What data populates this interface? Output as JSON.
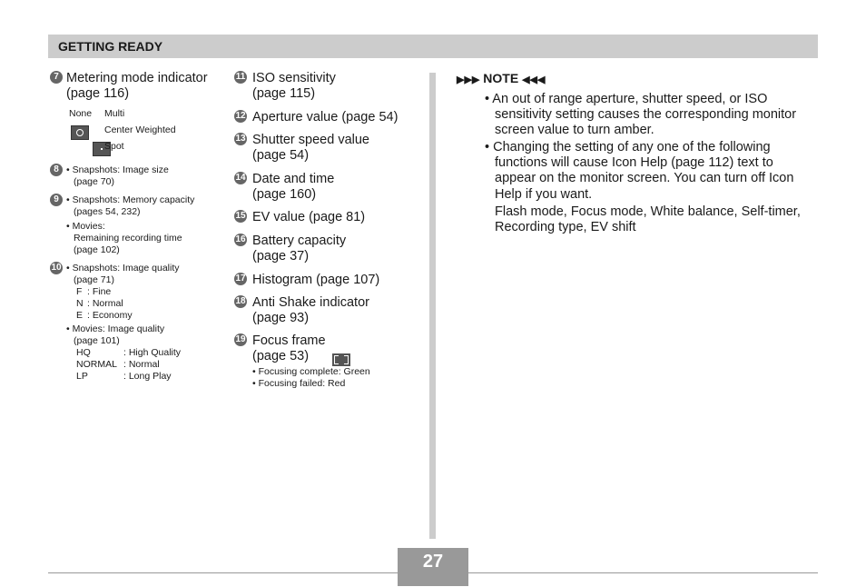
{
  "header": {
    "title": "GETTING READY"
  },
  "col1": {
    "item7": {
      "num": "7",
      "title": "Metering mode indicator",
      "page": "(page 116)"
    },
    "metering": [
      {
        "icon": "none",
        "label": "None",
        "name": "Multi"
      },
      {
        "icon": "center-weighted-icon",
        "name": "Center Weighted"
      },
      {
        "icon": "spot-icon",
        "name": "Spot"
      }
    ],
    "item8": {
      "num": "8",
      "lines": [
        "• Snapshots: Image size",
        "(page 70)"
      ]
    },
    "item9": {
      "num": "9",
      "lines": [
        "• Snapshots: Memory capacity",
        "(pages 54, 232)"
      ],
      "movies": [
        "• Movies:",
        "Remaining recording time",
        "(page 102)"
      ]
    },
    "item10": {
      "num": "10",
      "lines": [
        "• Snapshots: Image quality",
        "(page 71)"
      ],
      "snap_q": [
        {
          "k": "F",
          "v": ": Fine"
        },
        {
          "k": "N",
          "v": ": Normal"
        },
        {
          "k": "E",
          "v": ": Economy"
        }
      ],
      "movies": [
        "• Movies: Image quality",
        "(page 101)"
      ],
      "movie_q": [
        {
          "k": "HQ",
          "v": ": High Quality"
        },
        {
          "k": "NORMAL",
          "v": ": Normal"
        },
        {
          "k": "LP",
          "v": ": Long Play"
        }
      ]
    }
  },
  "col2": {
    "items": [
      {
        "num": "11",
        "line1": "ISO sensitivity",
        "line2": "(page 115)"
      },
      {
        "num": "12",
        "line1": "Aperture value (page 54)",
        "line2": ""
      },
      {
        "num": "13",
        "line1": "Shutter speed value",
        "line2": "(page 54)"
      },
      {
        "num": "14",
        "line1": "Date and time",
        "line2": "(page 160)"
      },
      {
        "num": "15",
        "line1": "EV value (page 81)",
        "line2": ""
      },
      {
        "num": "16",
        "line1": "Battery capacity",
        "line2": "(page 37)"
      },
      {
        "num": "17",
        "line1": "Histogram (page 107)",
        "line2": ""
      },
      {
        "num": "18",
        "line1": "Anti Shake indicator",
        "line2": "(page 93)"
      },
      {
        "num": "19",
        "line1": "Focus frame",
        "line2": "(page 53)"
      }
    ],
    "focus_notes": [
      "•  Focusing complete: Green",
      "•  Focusing failed: Red"
    ]
  },
  "note": {
    "label": "NOTE",
    "bullets": [
      "• An out of range aperture, shutter speed, or ISO",
      "sensitivity setting causes the corresponding monitor",
      "screen value to turn amber.",
      "• Changing the setting of any one of the following",
      "functions will cause Icon Help (page 112) text to",
      "appear on the monitor screen. You can turn off Icon",
      "Help if you want.",
      "Flash mode, Focus mode, White balance, Self-timer,",
      "Recording type, EV shift"
    ]
  },
  "footer": {
    "page_number": "27"
  }
}
